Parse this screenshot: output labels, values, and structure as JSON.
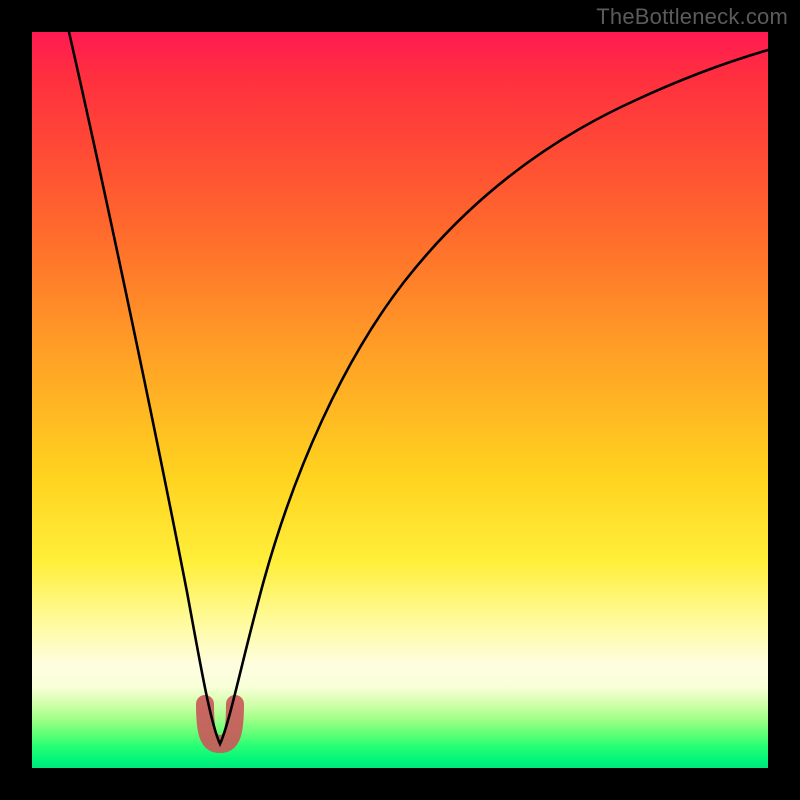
{
  "watermark": "TheBottleneck.com",
  "chart_data": {
    "type": "line",
    "title": "",
    "xlabel": "",
    "ylabel": "",
    "xlim": [
      0,
      100
    ],
    "ylim": [
      0,
      100
    ],
    "grid": false,
    "legend": false,
    "background_gradient": {
      "top_color": "#ff1a52",
      "mid_color": "#ffd21f",
      "bottom_color": "#00e87c",
      "description": "vertical heat gradient red→yellow→green"
    },
    "series": [
      {
        "name": "bottleneck-curve",
        "x": [
          5,
          8,
          11,
          14,
          17,
          20,
          22,
          24,
          25.5,
          27,
          29,
          32,
          36,
          42,
          50,
          60,
          72,
          86,
          100
        ],
        "y": [
          100,
          86,
          72,
          57,
          42,
          27,
          15,
          6,
          3,
          6,
          14,
          26,
          39,
          52,
          63,
          72,
          80,
          86,
          89
        ]
      }
    ],
    "markers": [
      {
        "name": "optimal-dip",
        "approximate_x": 25.5,
        "approximate_y": 4,
        "color": "#c85a5a",
        "shape": "rounded-u"
      }
    ]
  }
}
